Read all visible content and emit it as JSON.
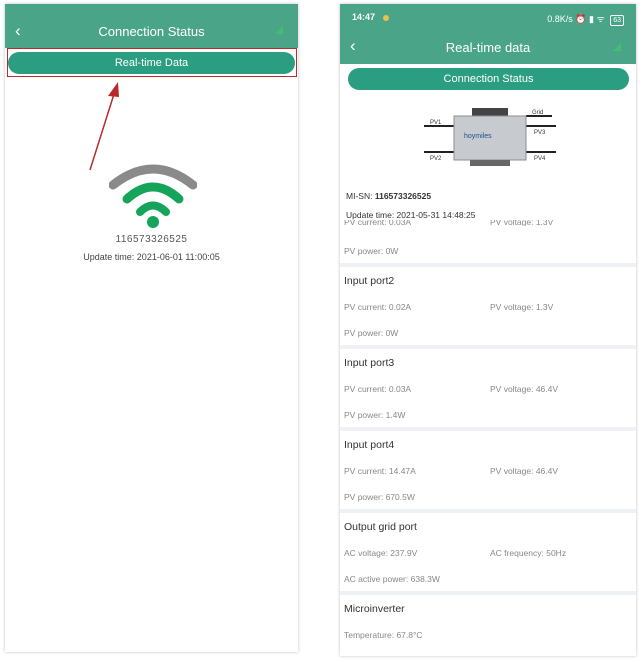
{
  "left": {
    "header_title": "Connection Status",
    "realtime_button": "Real-time Data",
    "serial": "116573326525",
    "update_time": "Update time: 2021-06-01 11:00:05"
  },
  "right": {
    "status_bar": {
      "time": "14:47",
      "right": "0.8K/s ⏰ ▮ ᯤ",
      "battery": "63"
    },
    "header_title": "Real-time data",
    "connection_button": "Connection Status",
    "product_labels": {
      "grid": "Grid",
      "pv1": "PV1",
      "pv2": "PV2",
      "pv3": "PV3",
      "pv4": "PV4",
      "brand": "hoymiles"
    },
    "mi_sn_label": "MI-SN:",
    "mi_sn_value": "116573326525",
    "update_time": "Update time: 2021-05-31 14:48:25",
    "partial": {
      "pv_current": "PV current: 0.03A",
      "pv_voltage": "PV voltage: 1.3V"
    },
    "port1_power": "PV power: 0W",
    "sections": {
      "port2": {
        "title": "Input port2",
        "current": "PV current: 0.02A",
        "voltage": "PV voltage: 1.3V",
        "power": "PV power: 0W"
      },
      "port3": {
        "title": "Input port3",
        "current": "PV current: 0.03A",
        "voltage": "PV voltage: 46.4V",
        "power": "PV power: 1.4W"
      },
      "port4": {
        "title": "Input port4",
        "current": "PV current: 14.47A",
        "voltage": "PV voltage: 46.4V",
        "power": "PV power: 670.5W"
      },
      "grid": {
        "title": "Output grid port",
        "ac_voltage": "AC voltage: 237.9V",
        "ac_frequency": "AC frequency: 50Hz",
        "ac_power": "AC active power: 638.3W"
      },
      "micro": {
        "title": "Microinverter",
        "temperature": "Temperature: 67.8°C"
      }
    }
  },
  "colors": {
    "header": "#4aa588",
    "button": "#2b9d80",
    "wifi_green": "#16a45a",
    "wifi_gray": "#8a8a8a",
    "annotation": "#b92b2b"
  }
}
